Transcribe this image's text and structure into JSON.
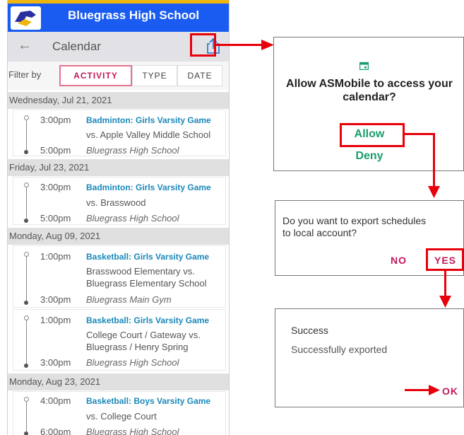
{
  "header": {
    "school_name": "Bluegrass High School",
    "page_title": "Calendar"
  },
  "filter": {
    "label": "Filter by",
    "tabs": [
      "ACTIVITY",
      "TYPE",
      "DATE"
    ],
    "selected": "ACTIVITY"
  },
  "days": [
    {
      "date": "Wednesday, Jul 21, 2021",
      "events": [
        {
          "start": "3:00pm",
          "end": "5:00pm",
          "name": "Badminton: Girls Varsity Game",
          "opponent": "vs. Apple Valley Middle School",
          "location": "Bluegrass High School"
        }
      ]
    },
    {
      "date": "Friday, Jul 23, 2021",
      "events": [
        {
          "start": "3:00pm",
          "end": "5:00pm",
          "name": "Badminton: Girls Varsity Game",
          "opponent": "vs. Brasswood",
          "location": "Bluegrass High School"
        }
      ]
    },
    {
      "date": "Monday, Aug 09, 2021",
      "events": [
        {
          "start": "1:00pm",
          "end": "3:00pm",
          "name": "Basketball: Girls Varsity Game",
          "opponent_line1": "Brasswood Elementary vs.",
          "opponent_line2": "Bluegrass Elementary School",
          "location": "Bluegrass Main Gym"
        },
        {
          "start": "1:00pm",
          "end": "3:00pm",
          "name": "Basketball: Girls Varsity Game",
          "opponent_line1": "College Court / Gateway vs.",
          "opponent_line2": "Bluegrass / Henry Spring",
          "location": "Bluegrass High School"
        }
      ]
    },
    {
      "date": "Monday, Aug 23, 2021",
      "events": [
        {
          "start": "4:00pm",
          "end": "6:00pm",
          "name": "Basketball: Boys Varsity Game",
          "opponent": "vs. College Court",
          "location": "Bluegrass High School"
        }
      ]
    }
  ],
  "permission_dialog": {
    "question": "Allow ASMobile to access your calendar?",
    "allow": "Allow",
    "deny": "Deny"
  },
  "export_dialog": {
    "question_line1": "Do you want to export schedules",
    "question_line2": "to local account?",
    "no": "NO",
    "yes": "YES"
  },
  "success_dialog": {
    "title": "Success",
    "message": "Successfully exported",
    "ok": "OK"
  },
  "colors": {
    "header_blue": "#1a5cf1",
    "accent_pink": "#c2185b",
    "event_blue": "#1a88ba",
    "allow_green": "#1a9e6c",
    "highlight_red": "#e8000b"
  },
  "icons": [
    "logo-icon",
    "back-arrow-icon",
    "share-icon",
    "calendar-icon",
    "arrow-right-icon",
    "arrow-down-icon"
  ]
}
